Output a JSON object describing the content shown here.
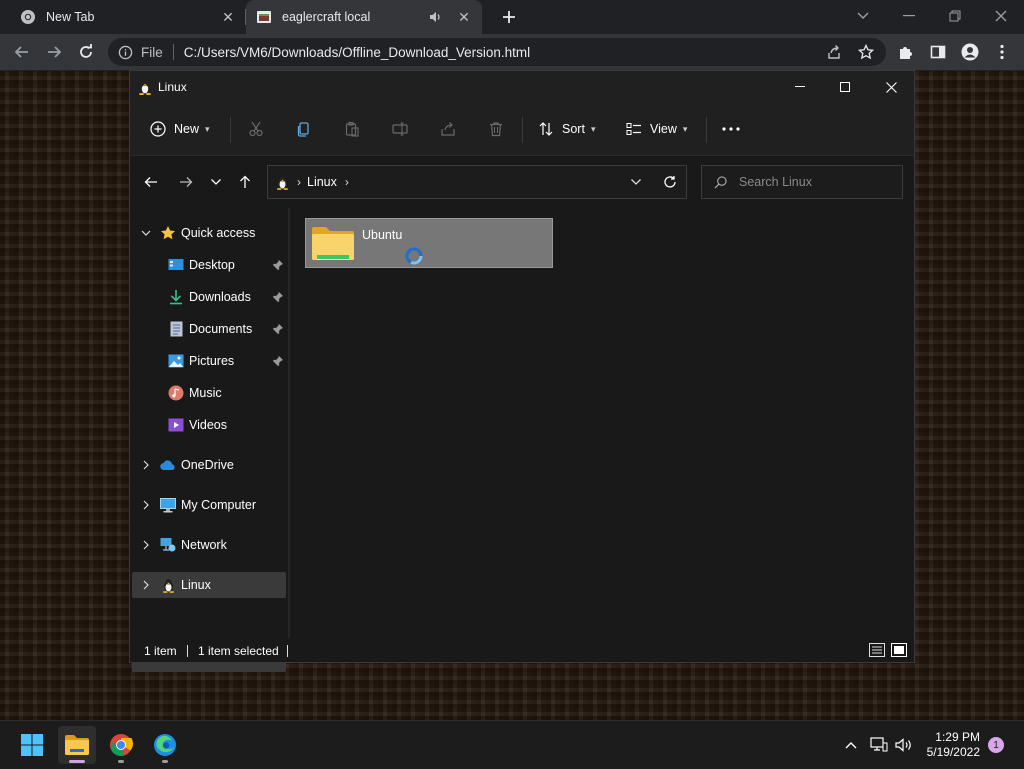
{
  "browser": {
    "tabs": [
      {
        "title": "New Tab",
        "icon": "chrome-icon",
        "active": false
      },
      {
        "title": "eaglercraft local",
        "icon": "page-favicon",
        "active": true,
        "audio": true
      }
    ],
    "omnibox": {
      "site_label": "File",
      "url": "C:/Users/VM6/Downloads/Offline_Download_Version.html"
    }
  },
  "explorer": {
    "title": "Linux",
    "commandbar": {
      "new_label": "New",
      "sort_label": "Sort",
      "view_label": "View",
      "icons": [
        "cut-icon",
        "copy-icon",
        "paste-icon",
        "rename-icon",
        "share-icon",
        "delete-icon"
      ]
    },
    "address": {
      "path": [
        "Linux"
      ]
    },
    "search": {
      "placeholder": "Search Linux"
    },
    "sidebar": {
      "quick_access": "Quick access",
      "quick_items": [
        {
          "label": "Desktop",
          "icon": "desktop-icon",
          "pinned": true
        },
        {
          "label": "Downloads",
          "icon": "download-icon",
          "pinned": true
        },
        {
          "label": "Documents",
          "icon": "documents-icon",
          "pinned": true
        },
        {
          "label": "Pictures",
          "icon": "pictures-icon",
          "pinned": true
        },
        {
          "label": "Music",
          "icon": "music-icon",
          "pinned": false
        },
        {
          "label": "Videos",
          "icon": "videos-icon",
          "pinned": false
        }
      ],
      "roots": [
        {
          "label": "OneDrive",
          "icon": "cloud-icon"
        },
        {
          "label": "My Computer",
          "icon": "computer-icon"
        },
        {
          "label": "Network",
          "icon": "network-icon"
        },
        {
          "label": "Linux",
          "icon": "linux-tux-icon",
          "selected": true
        }
      ]
    },
    "content": {
      "items": [
        {
          "name": "Ubuntu",
          "type": "folder",
          "selected": true,
          "loading": true
        }
      ]
    },
    "status": {
      "count": "1 item",
      "selection": "1 item selected"
    }
  },
  "taskbar": {
    "apps": [
      "start-icon",
      "file-explorer-icon",
      "chrome-icon",
      "edge-icon"
    ],
    "time": "1:29 PM",
    "date": "5/19/2022",
    "notifications": "1"
  },
  "colors": {
    "accent": "#0078d4",
    "folder": "#f3c74c",
    "selection": "#777777"
  }
}
